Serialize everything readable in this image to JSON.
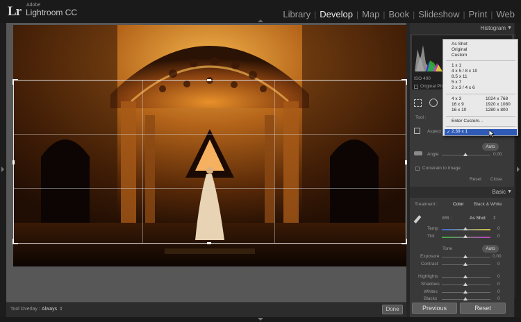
{
  "app": {
    "logo": "Lr",
    "vendor": "Adobe",
    "name": "Lightroom CC"
  },
  "modules": [
    {
      "label": "Library",
      "active": false
    },
    {
      "label": "Develop",
      "active": true
    },
    {
      "label": "Map",
      "active": false
    },
    {
      "label": "Book",
      "active": false
    },
    {
      "label": "Slideshow",
      "active": false
    },
    {
      "label": "Print",
      "active": false
    },
    {
      "label": "Web",
      "active": false
    }
  ],
  "toolbar": {
    "tool_overlay_label": "Tool Overlay :",
    "tool_overlay_value": "Always",
    "done_label": "Done"
  },
  "histogram": {
    "header": "Histogram",
    "iso": "ISO 400",
    "original_label": "Original Ph"
  },
  "crop_panel": {
    "tool_label": "Tool :",
    "aspect_label": "Aspect",
    "auto_label": "Auto",
    "angle_label": "Angle",
    "angle_value": "0.00",
    "constrain_label": "Constrain to Image",
    "reset_label": "Reset",
    "close_label": "Close"
  },
  "aspect_menu": {
    "group1": [
      "As Shot",
      "Original",
      "Custom"
    ],
    "group2": [
      "1 x 1",
      "4 x 5  /  8 x 10",
      "8.5 x 11",
      "5 x 7",
      "2 x 3  /  4 x 6"
    ],
    "group3_left": [
      "4 x 3",
      "16 x 9",
      "16 x 10"
    ],
    "group3_right": [
      "1024 x 768",
      "1920 x 1080",
      "1280 x 800"
    ],
    "enter_custom": "Enter Custom...",
    "selected": "2.39 x 1",
    "check": "✓"
  },
  "basic": {
    "header": "Basic",
    "treatment_label": "Treatment :",
    "color_label": "Color",
    "bw_label": "Black & White",
    "wb_label": "WB :",
    "wb_value": "As Shot",
    "tone_label": "Tone",
    "tone_auto": "Auto",
    "sliders": [
      {
        "label": "Temp",
        "value": "0"
      },
      {
        "label": "Tint",
        "value": "0"
      },
      {
        "label": "Exposure",
        "value": "0.00"
      },
      {
        "label": "Contrast",
        "value": "0"
      },
      {
        "label": "Highlights",
        "value": "0"
      },
      {
        "label": "Shadows",
        "value": "0"
      },
      {
        "label": "Whites",
        "value": "0"
      },
      {
        "label": "Blacks",
        "value": "0"
      }
    ]
  },
  "footer": {
    "previous_label": "Previous",
    "reset_label": "Reset"
  },
  "colors": {
    "dropdown_highlight": "#2f5bb7",
    "photo_warm": "#c8731c",
    "background": "#262626"
  },
  "icons": [
    "crop-icon",
    "spot-removal-icon",
    "aspect-lock-icon",
    "angle-level-icon",
    "eyedropper-icon"
  ]
}
